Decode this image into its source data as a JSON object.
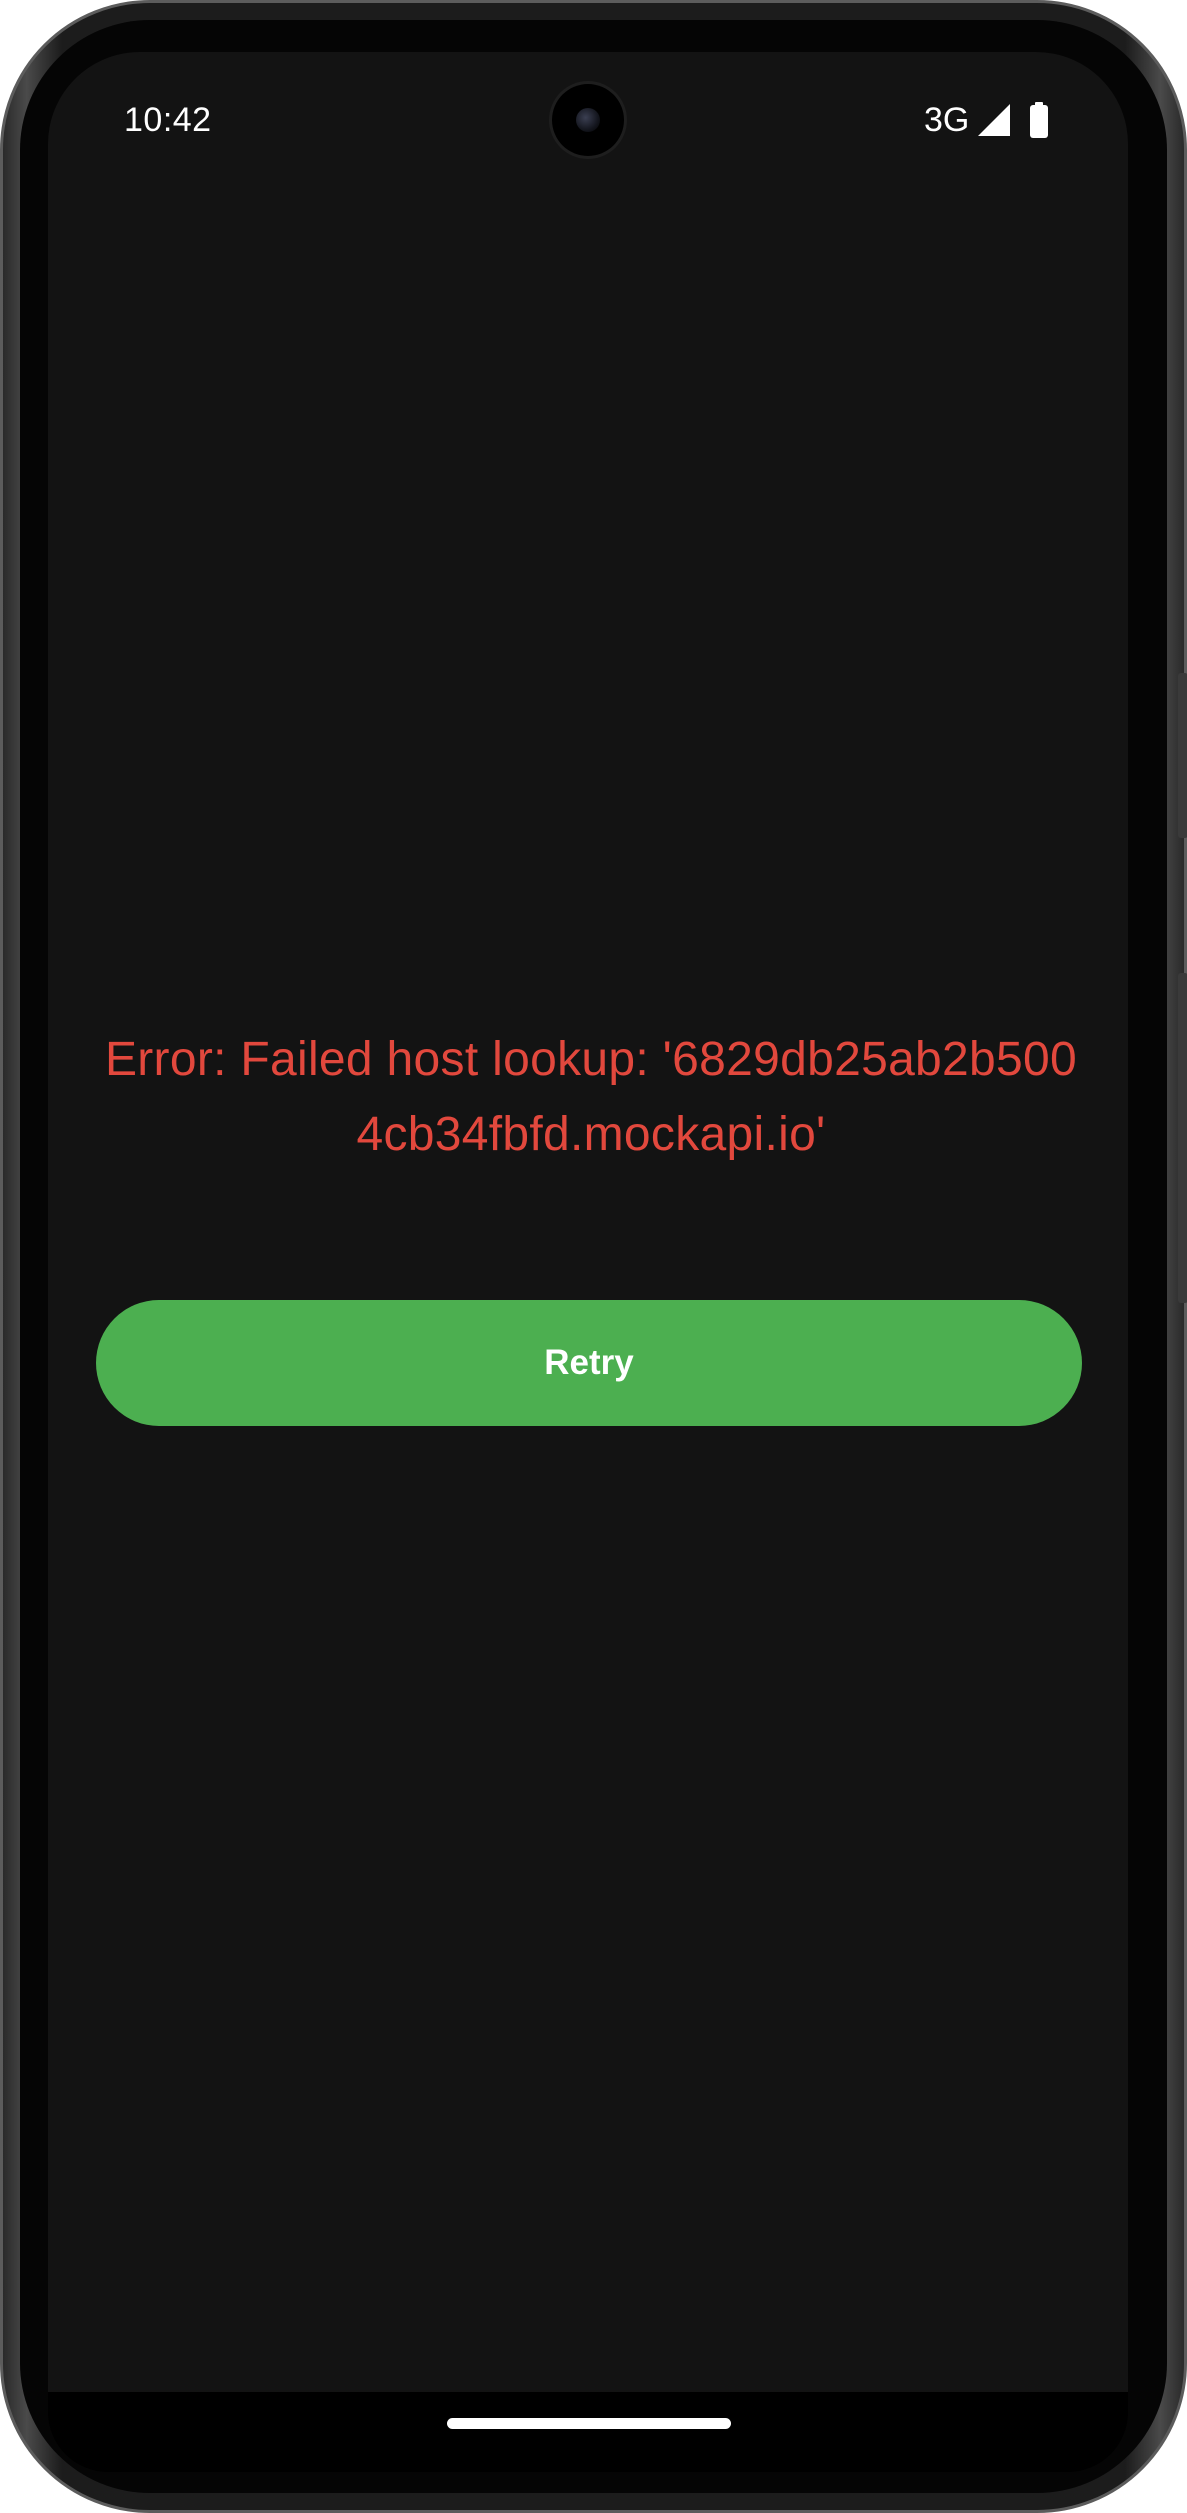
{
  "status_bar": {
    "time": "10:42",
    "network": "3G",
    "icons": [
      "signal-icon",
      "battery-icon"
    ]
  },
  "error": {
    "message": "Error: Failed host lookup: '6829db25ab2b5004cb34fbfd.mockapi.io'",
    "color": "#e2483d"
  },
  "retry_button": {
    "label": "Retry",
    "color": "#4caf50"
  },
  "theme": {
    "background": "#131313"
  }
}
